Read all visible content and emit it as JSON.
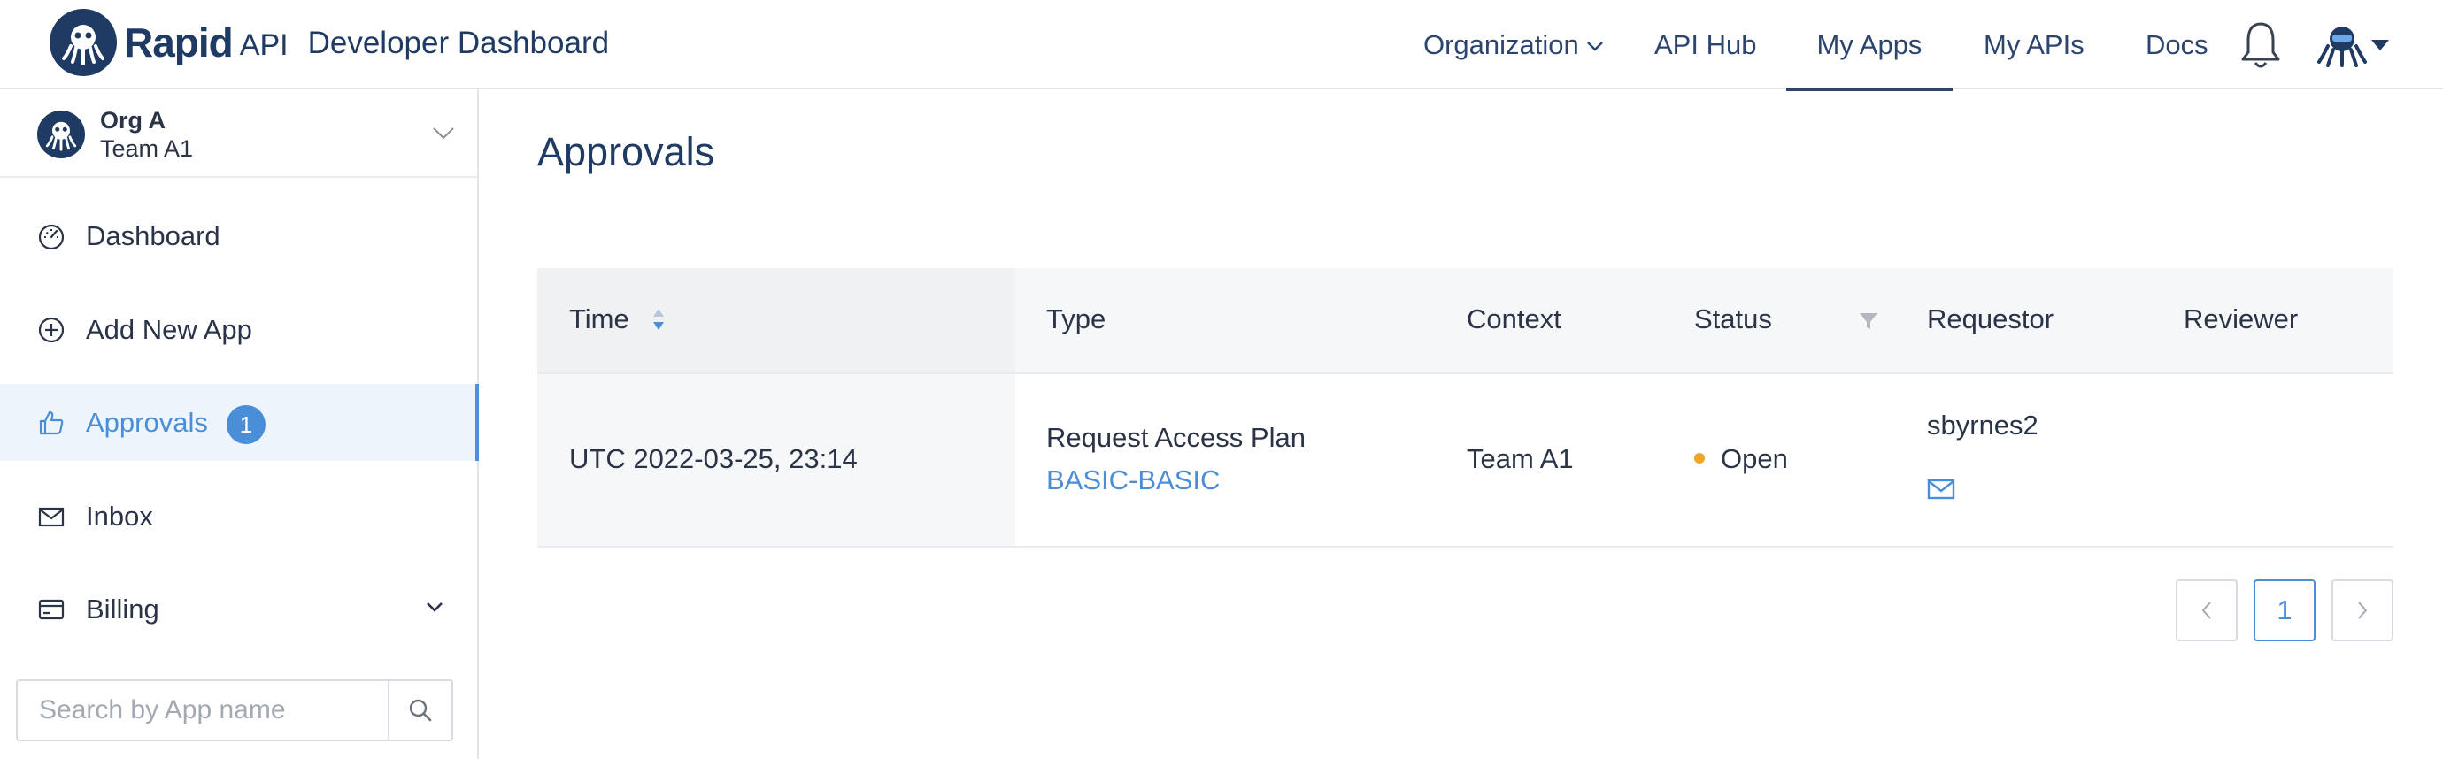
{
  "header": {
    "logo_primary": "Rapid",
    "logo_secondary": "API",
    "app_title": "Developer Dashboard",
    "nav": [
      {
        "label": "Organization",
        "has_dropdown": true
      },
      {
        "label": "API Hub"
      },
      {
        "label": "My Apps",
        "active": true
      },
      {
        "label": "My APIs"
      },
      {
        "label": "Docs"
      }
    ],
    "notification_icon": "bell-icon",
    "user_icon": "octopus-avatar-icon"
  },
  "sidebar": {
    "org": {
      "name": "Org A",
      "team": "Team A1"
    },
    "items": [
      {
        "label": "Dashboard",
        "icon": "speedometer-icon"
      },
      {
        "label": "Add New App",
        "icon": "plus-circle-icon"
      },
      {
        "label": "Approvals",
        "icon": "thumbs-up-icon",
        "badge": "1",
        "active": true
      },
      {
        "label": "Inbox",
        "icon": "envelope-icon"
      },
      {
        "label": "Billing",
        "icon": "credit-card-icon",
        "has_dropdown": true
      }
    ],
    "search": {
      "placeholder": "Search by App name"
    }
  },
  "main": {
    "title": "Approvals",
    "table": {
      "columns": [
        "Time",
        "Type",
        "Context",
        "Status",
        "Requestor",
        "Reviewer"
      ],
      "rows": [
        {
          "time": "UTC 2022-03-25, 23:14",
          "type": "Request Access Plan",
          "type_link": "BASIC-BASIC",
          "context": "Team A1",
          "status": "Open",
          "requestor": "sbyrnes2",
          "reviewer": ""
        }
      ]
    },
    "pagination": {
      "current": "1"
    }
  },
  "colors": {
    "brand_navy": "#1f3b63",
    "accent_blue": "#4a8ed8",
    "status_open": "#f0a623"
  }
}
